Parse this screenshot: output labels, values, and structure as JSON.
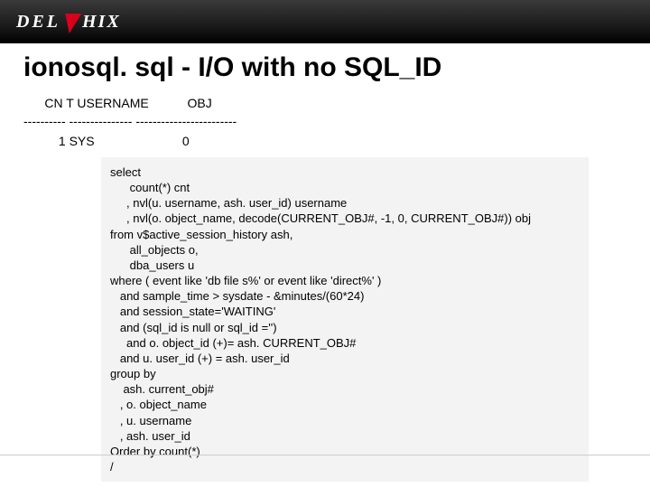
{
  "brand": {
    "prefix": "DEL",
    "suffix": "HIX"
  },
  "title": "ionosql. sql  - I/O with no SQL_ID",
  "table": {
    "header_line": "      CN T USERNAME           OBJ",
    "separator_line": "---------- --------------- ------------------------",
    "row_line": "          1 SYS                         0"
  },
  "sql_code": "select\n      count(*) cnt\n     , nvl(u. username, ash. user_id) username\n     , nvl(o. object_name, decode(CURRENT_OBJ#, -1, 0, CURRENT_OBJ#)) obj\nfrom v$active_session_history ash,\n      all_objects o,\n      dba_users u\nwhere ( event like 'db file s%' or event like 'direct%' )\n   and sample_time > sysdate - &minutes/(60*24)\n   and session_state='WAITING'\n   and (sql_id is null or sql_id ='')\n     and o. object_id (+)= ash. CURRENT_OBJ#\n   and u. user_id (+) = ash. user_id\ngroup by\n    ash. current_obj#\n   , o. object_name\n   , u. username\n   , ash. user_id\nOrder by count(*)\n/"
}
